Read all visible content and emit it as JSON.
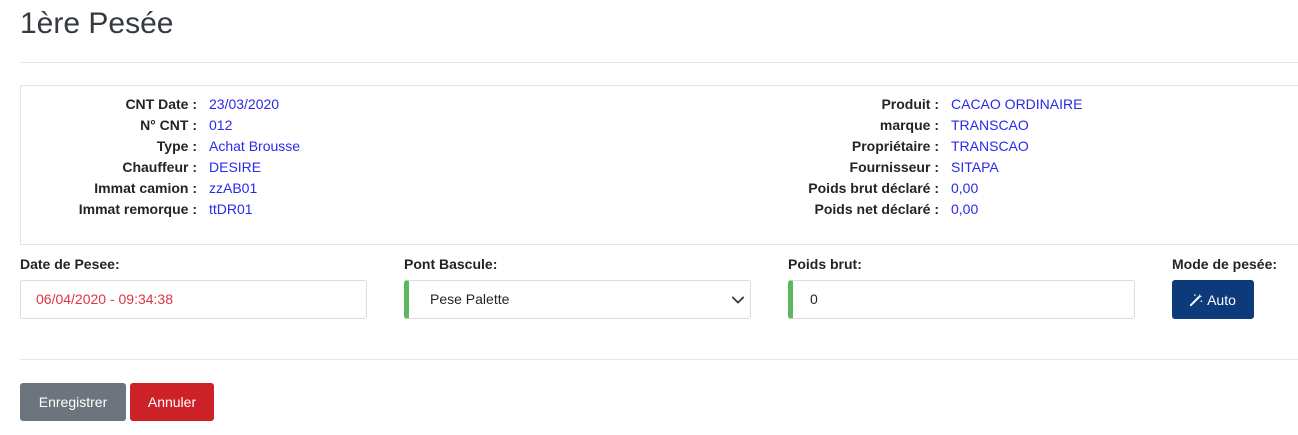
{
  "page": {
    "title": "1ère Pesée"
  },
  "info": {
    "left": [
      {
        "label": "CNT Date :",
        "value": "23/03/2020"
      },
      {
        "label": "N° CNT :",
        "value": "012"
      },
      {
        "label": "Type :",
        "value": "Achat Brousse"
      },
      {
        "label": "Chauffeur :",
        "value": "DESIRE"
      },
      {
        "label": "Immat camion :",
        "value": "zzAB01"
      },
      {
        "label": "Immat remorque :",
        "value": "ttDR01"
      }
    ],
    "right": [
      {
        "label": "Produit :",
        "value": "CACAO ORDINAIRE"
      },
      {
        "label": "marque :",
        "value": "TRANSCAO"
      },
      {
        "label": "Propriétaire :",
        "value": "TRANSCAO"
      },
      {
        "label": "Fournisseur :",
        "value": "SITAPA"
      },
      {
        "label": "Poids brut déclaré :",
        "value": "0,00"
      },
      {
        "label": "Poids net déclaré :",
        "value": "0,00"
      }
    ]
  },
  "form": {
    "date_label": "Date de Pesee:",
    "date_value": "06/04/2020 - 09:34:38",
    "pont_label": "Pont Bascule:",
    "pont_value": "Pese Palette",
    "poids_label": "Poids brut:",
    "poids_value": "0",
    "mode_label": "Mode de pesée:",
    "mode_button": "Auto",
    "mode_icon": "magic-wand-icon"
  },
  "actions": {
    "save": "Enregistrer",
    "cancel": "Annuler"
  },
  "colors": {
    "value_text": "#2a2ae8",
    "date_text": "#dc3545",
    "field_accent": "#5cb85c",
    "auto_button": "#0d3a7a",
    "save_button": "#6c757d",
    "cancel_button": "#cc2127"
  }
}
